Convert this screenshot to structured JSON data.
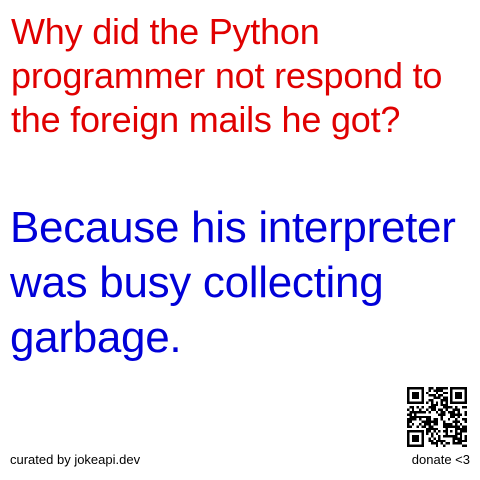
{
  "colors": {
    "setup": "#e00000",
    "delivery": "#0000d8",
    "footer": "#000000"
  },
  "joke": {
    "setup": "Why did the Python programmer not respond to the foreign mails he got?",
    "delivery": "Because his interpreter was busy collecting garbage."
  },
  "footer": {
    "credit": "curated by jokeapi.dev",
    "donate": "donate <3"
  },
  "qr_icon": "qr-code-icon"
}
